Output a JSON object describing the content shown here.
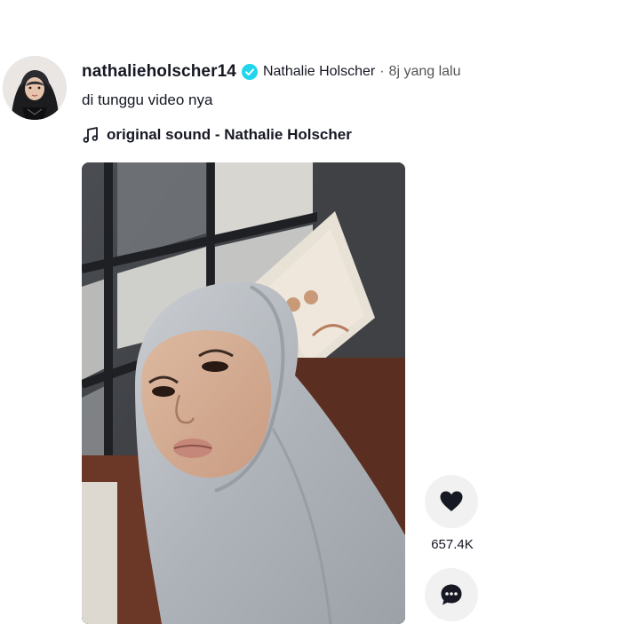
{
  "post": {
    "username": "nathalieholscher14",
    "nickname": "Nathalie Holscher",
    "separator": "·",
    "time_ago": "8j yang lalu",
    "caption": "di tunggu video nya",
    "sound": "original sound - Nathalie Holscher"
  },
  "actions": {
    "like_count": "657.4K"
  },
  "icons": {
    "verified": "verified-badge-icon",
    "music": "music-note-icon",
    "like": "heart-icon",
    "comment": "comment-icon"
  },
  "colors": {
    "verified_badge": "#20d5ec",
    "text_primary": "#161823",
    "text_secondary": "#555555",
    "action_button_bg": "#f1f1f2"
  }
}
